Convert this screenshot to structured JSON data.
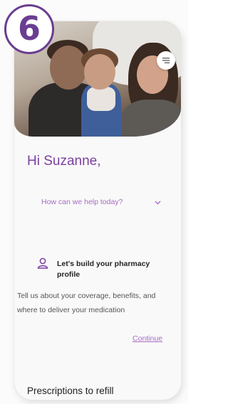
{
  "step_badge": {
    "number": "6",
    "color": "#6a3d92"
  },
  "header": {
    "menu_icon": "hamburger-icon"
  },
  "greeting": {
    "text": "Hi Suzanne,",
    "color": "#7b3fa0"
  },
  "help_select": {
    "selected": "How can we help today?",
    "icon": "chevron-down-icon"
  },
  "profile_card": {
    "icon": "user-icon",
    "title": "Let's build your pharmacy profile",
    "body": "Tell us about your coverage, benefits, and where to deliver your medication",
    "continue_label": "Continue",
    "accent": "#a66cc4"
  },
  "prescriptions": {
    "title": "Prescriptions to refill"
  }
}
